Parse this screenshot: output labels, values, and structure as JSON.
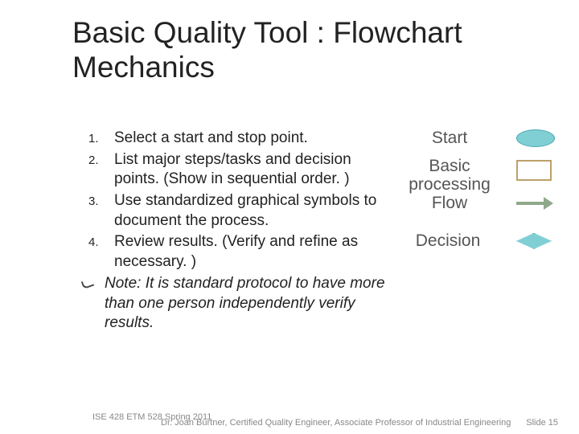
{
  "title": "Basic Quality Tool : Flowchart Mechanics",
  "steps": [
    "Select a start and stop point.",
    "List major steps/tasks and decision points.  (Show in sequential order. )",
    "Use standardized graphical symbols to document the process.",
    "Review results. (Verify and refine as necessary. )"
  ],
  "note": "Note: It is standard protocol to have more than one person independently verify results.",
  "legend": {
    "start": "Start",
    "basic": "Basic processing Flow",
    "decision": "Decision"
  },
  "footer": {
    "left": "ISE 428 ETM 528 Spring 2011",
    "mid": "Dr. Joan Burtner, Certified Quality Engineer, Associate Professor of Industrial Engineering",
    "right": "Slide 15"
  }
}
